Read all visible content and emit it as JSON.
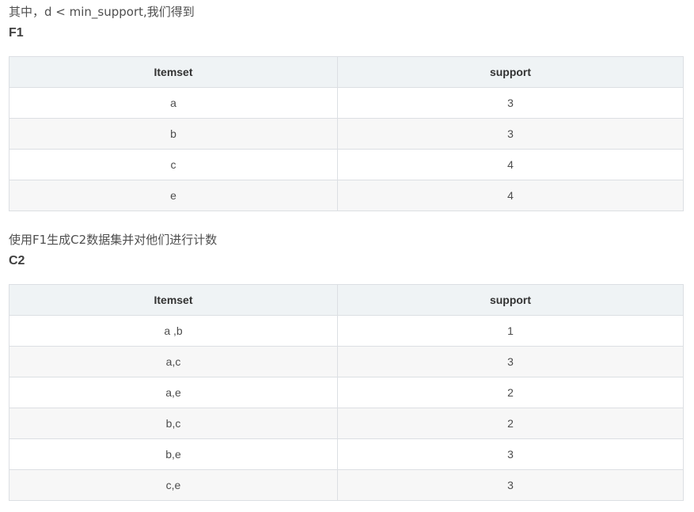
{
  "section1": {
    "intro": "其中，d < min_support,我们得到",
    "heading": "F1",
    "table": {
      "headers": [
        "Itemset",
        "support"
      ],
      "rows": [
        [
          "a",
          "3"
        ],
        [
          "b",
          "3"
        ],
        [
          "c",
          "4"
        ],
        [
          "e",
          "4"
        ]
      ]
    }
  },
  "section2": {
    "intro": "使用F1生成C2数据集并对他们进行计数",
    "heading": "C2",
    "table": {
      "headers": [
        "Itemset",
        "support"
      ],
      "rows": [
        [
          "a ,b",
          "1"
        ],
        [
          "a,c",
          "3"
        ],
        [
          "a,e",
          "2"
        ],
        [
          "b,c",
          "2"
        ],
        [
          "b,e",
          "3"
        ],
        [
          "c,e",
          "3"
        ]
      ]
    }
  }
}
